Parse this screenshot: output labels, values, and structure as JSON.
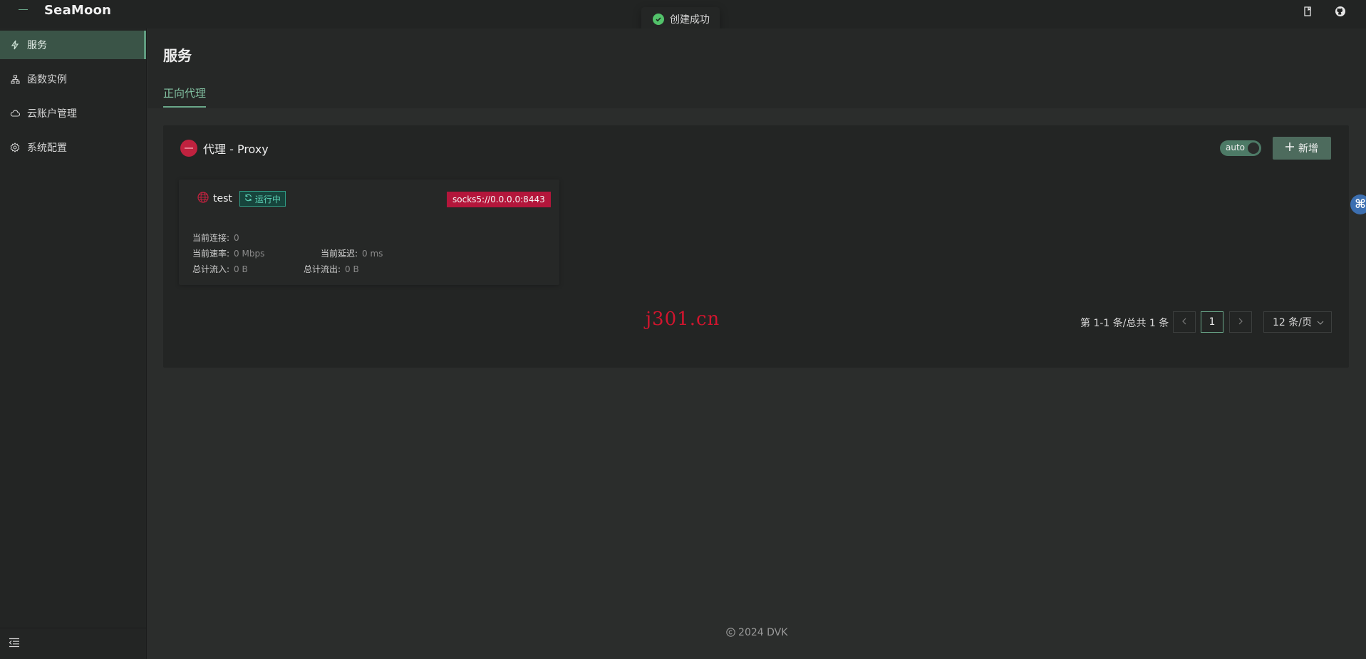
{
  "app": {
    "title": "SeaMoon"
  },
  "toast": {
    "message": "创建成功"
  },
  "sidebar": {
    "items": [
      {
        "label": "服务",
        "icon": "lightning-icon",
        "active": true
      },
      {
        "label": "函数实例",
        "icon": "sitemap-icon",
        "active": false
      },
      {
        "label": "云账户管理",
        "icon": "cloud-icon",
        "active": false
      },
      {
        "label": "系统配置",
        "icon": "gear-icon",
        "active": false
      }
    ]
  },
  "page": {
    "title": "服务",
    "tabs": [
      {
        "label": "正向代理",
        "active": true
      }
    ]
  },
  "card": {
    "title": "代理 - Proxy",
    "toggle_label": "auto",
    "add_label": "新增"
  },
  "service": {
    "name": "test",
    "status": "运行中",
    "address": "socks5://0.0.0.0:8443",
    "metrics": {
      "connections_label": "当前连接:",
      "connections_value": "0",
      "rate_label": "当前速率:",
      "rate_value": "0 Mbps",
      "latency_label": "当前延迟:",
      "latency_value": "0 ms",
      "in_label": "总计流入:",
      "in_value": "0 B",
      "out_label": "总计流出:",
      "out_value": "0 B"
    }
  },
  "pagination": {
    "summary": "第 1-1 条/总共 1 条",
    "current_page": "1",
    "page_size": "12 条/页"
  },
  "watermark": "j301.cn",
  "footer": {
    "text": "2024 DVK"
  },
  "colors": {
    "accent": "#6aa88a",
    "danger": "#b3163b",
    "status": "#5dd4b8",
    "success": "#52c26a"
  }
}
